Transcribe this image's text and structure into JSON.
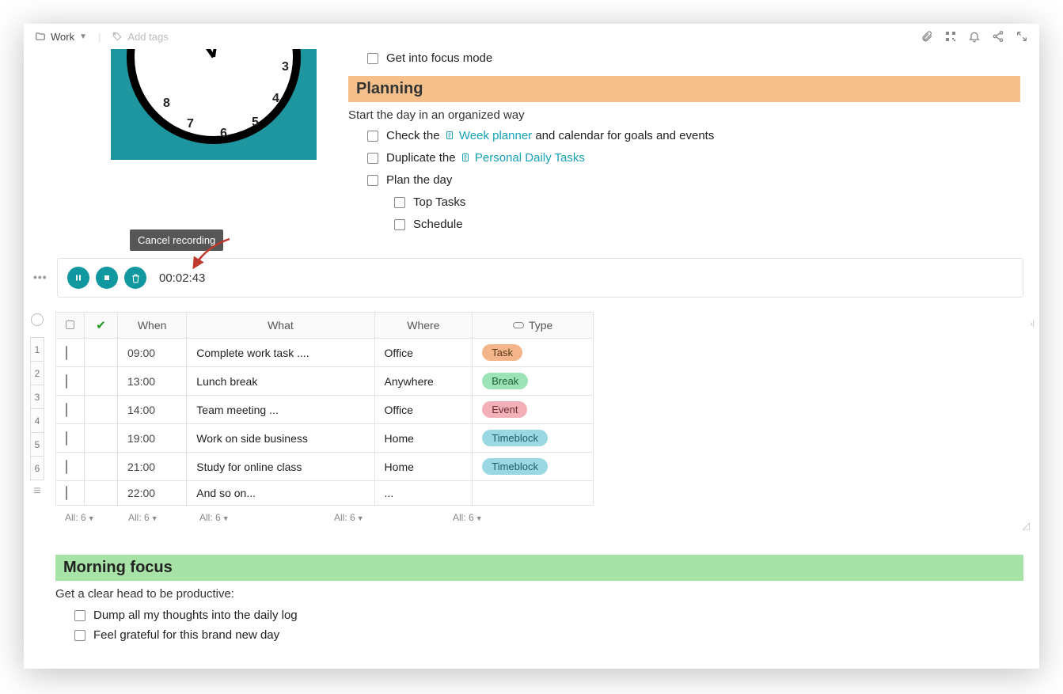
{
  "topbar": {
    "breadcrumb": "Work",
    "add_tags": "Add tags"
  },
  "focus_task": "Get into focus mode",
  "planning": {
    "title": "Planning",
    "subtitle": "Start the day in an organized way",
    "items": [
      {
        "prefix": "Check the ",
        "link": "Week planner",
        "suffix": " and calendar for goals and events"
      },
      {
        "prefix": "Duplicate the  ",
        "link": "Personal Daily Tasks",
        "suffix": ""
      },
      {
        "prefix": "Plan the day",
        "link": "",
        "suffix": ""
      }
    ],
    "sub_items": [
      "Top Tasks",
      "Schedule"
    ]
  },
  "recording": {
    "tooltip": "Cancel recording",
    "timer": "00:02:43"
  },
  "table": {
    "headers": {
      "when": "When",
      "what": "What",
      "where": "Where",
      "type": "Type"
    },
    "rows": [
      {
        "n": "1",
        "when": "09:00",
        "what": "Complete work task ....",
        "where": "Office",
        "type": "Task",
        "pill": "pill-task"
      },
      {
        "n": "2",
        "when": "13:00",
        "what": "Lunch break",
        "where": "Anywhere",
        "type": "Break",
        "pill": "pill-break"
      },
      {
        "n": "3",
        "when": "14:00",
        "what": "Team meeting ...",
        "where": "Office",
        "type": "Event",
        "pill": "pill-event"
      },
      {
        "n": "4",
        "when": "19:00",
        "what": "Work on side business",
        "where": "Home",
        "type": "Timeblock",
        "pill": "pill-timeblock"
      },
      {
        "n": "5",
        "when": "21:00",
        "what": "Study for online class",
        "where": "Home",
        "type": "Timeblock",
        "pill": "pill-timeblock"
      },
      {
        "n": "6",
        "when": "22:00",
        "what": "And so on...",
        "where": "...",
        "type": "",
        "pill": ""
      }
    ],
    "footer": "All: 6"
  },
  "morning_focus": {
    "title": "Morning focus",
    "subtitle": "Get a clear head to be productive:",
    "items": [
      "Dump all my thoughts into the daily log",
      "Feel grateful for this brand new day"
    ]
  }
}
